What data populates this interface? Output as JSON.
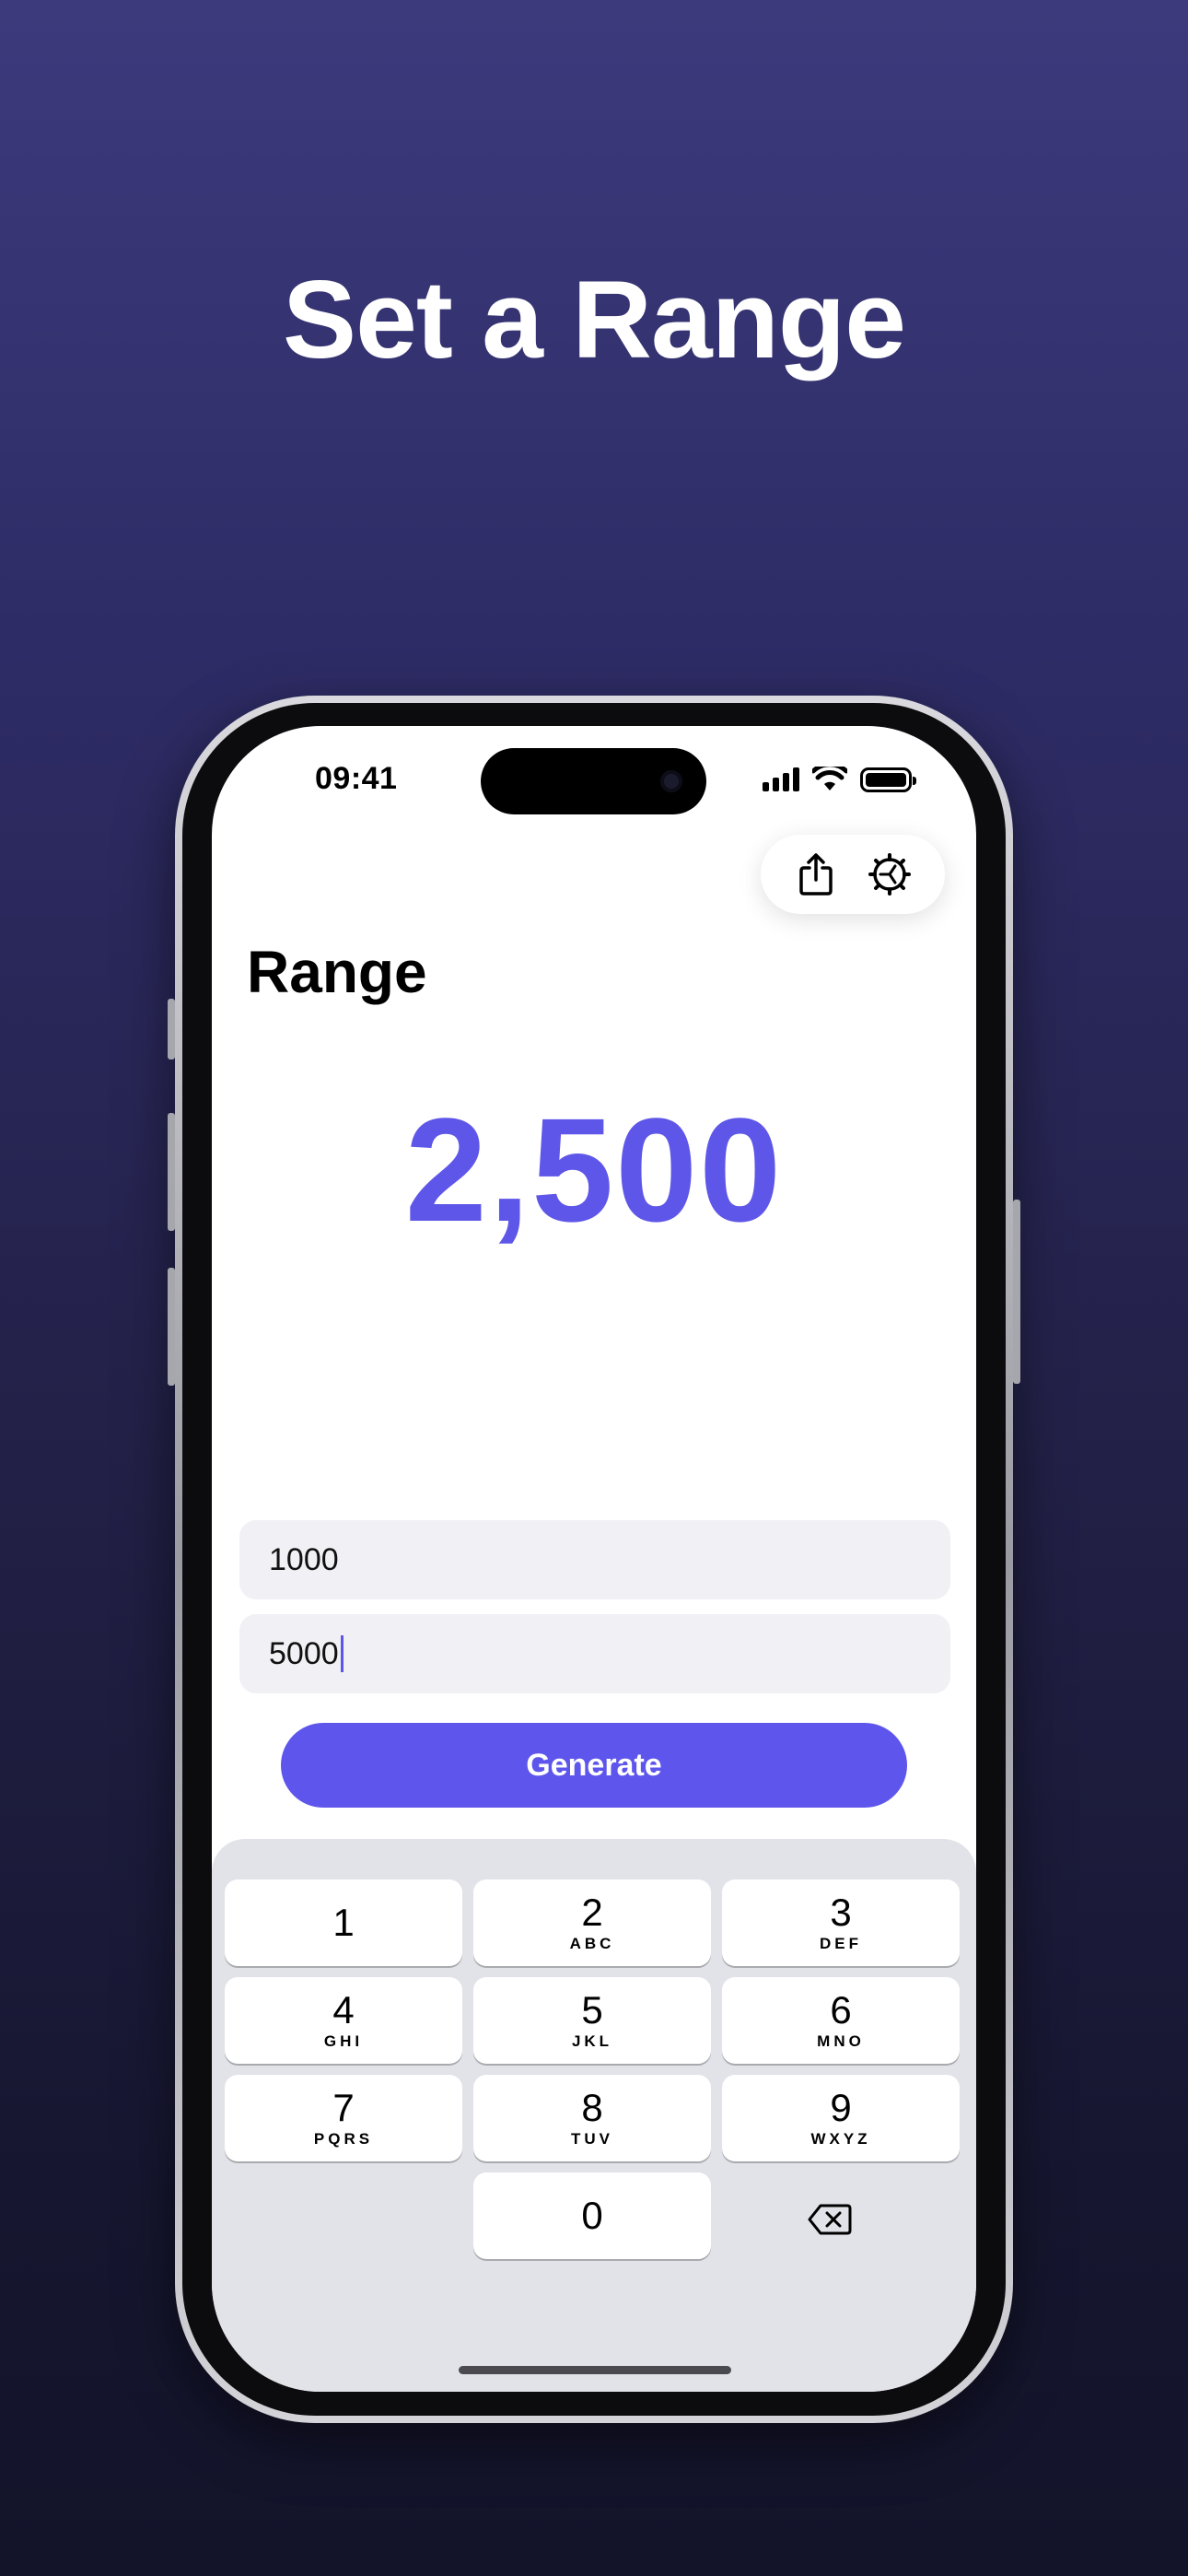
{
  "headline": "Set a Range",
  "status_bar": {
    "time": "09:41"
  },
  "toolbar": {
    "share_icon": "share-icon",
    "settings_icon": "gear-icon"
  },
  "nav": {
    "title": "Range"
  },
  "result": {
    "value": "2,500",
    "color": "#5e56e8"
  },
  "range": {
    "min_value": "1000",
    "max_value": "5000"
  },
  "generate_button": {
    "label": "Generate",
    "color": "#5e56ec"
  },
  "keypad": {
    "keys": [
      {
        "digit": "1",
        "letters": ""
      },
      {
        "digit": "2",
        "letters": "ABC"
      },
      {
        "digit": "3",
        "letters": "DEF"
      },
      {
        "digit": "4",
        "letters": "GHI"
      },
      {
        "digit": "5",
        "letters": "JKL"
      },
      {
        "digit": "6",
        "letters": "MNO"
      },
      {
        "digit": "7",
        "letters": "PQRS"
      },
      {
        "digit": "8",
        "letters": "TUV"
      },
      {
        "digit": "9",
        "letters": "WXYZ"
      },
      {
        "digit": "0",
        "letters": ""
      }
    ],
    "delete_icon": "backspace-icon"
  }
}
